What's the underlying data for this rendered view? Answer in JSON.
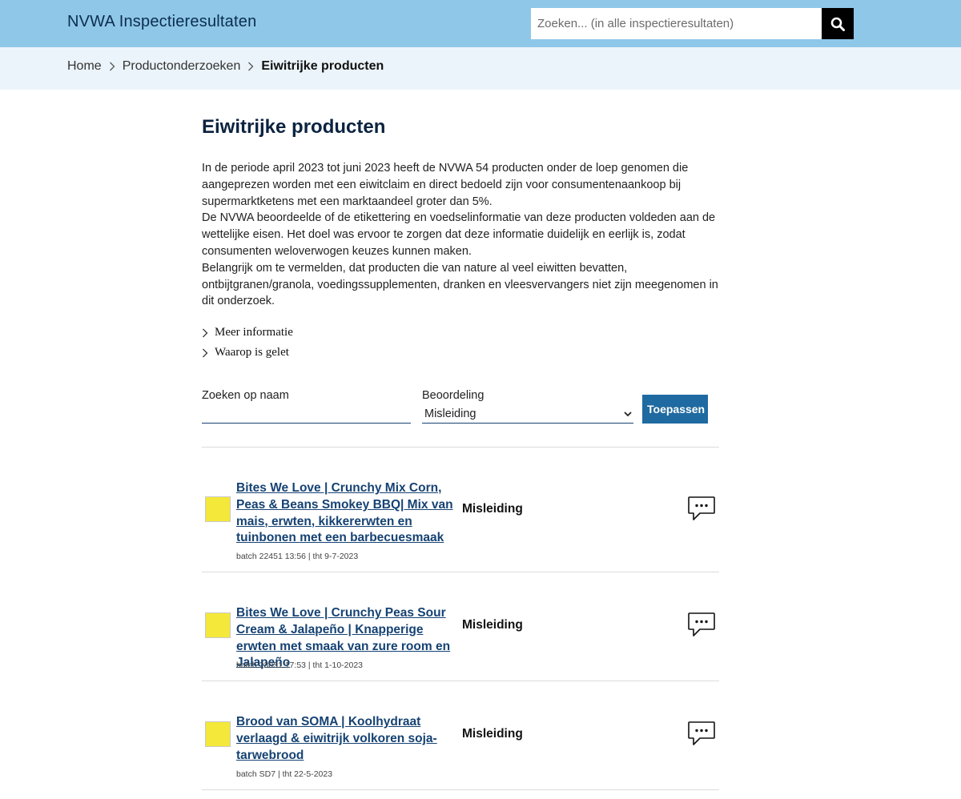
{
  "header": {
    "site_title": "NVWA Inspectieresultaten",
    "search_placeholder": "Zoeken... (in alle inspectieresultaten)"
  },
  "breadcrumb": {
    "items": [
      "Home",
      "Productonderzoeken"
    ],
    "current": "Eiwitrijke producten"
  },
  "page": {
    "title": "Eiwitrijke producten",
    "intro": [
      "In de periode april 2023 tot juni 2023 heeft de NVWA 54 producten onder de loep genomen die aangeprezen worden met een eiwitclaim en direct bedoeld zijn voor consumentenaankoop bij supermarktketens met een marktaandeel groter dan 5%.",
      "De NVWA beoordeelde of de etikettering en voedselinformatie van deze producten voldeden aan de wettelijke eisen. Het doel was ervoor te zorgen dat deze informatie duidelijk en eerlijk is, zodat consumenten weloverwogen keuzes kunnen maken.",
      "Belangrijk om te vermelden, dat producten die van nature al veel eiwitten bevatten, ontbijtgranen/granola, voedingssupplementen, dranken en vleesvervangers niet zijn meegenomen in dit onderzoek."
    ],
    "more_info_label": "Meer informatie",
    "attention_label": "Waarop is gelet"
  },
  "filters": {
    "name_label": "Zoeken op naam",
    "name_value": "",
    "rating_label": "Beoordeling",
    "rating_selected": "Misleiding",
    "apply_label": "Toepassen"
  },
  "colors": {
    "header_bg": "#8fc7e8",
    "breadcrumb_bg": "#ebf4fa",
    "link": "#154273",
    "button": "#1f6aa0",
    "rating_swatch": "#f4e83a"
  },
  "results": [
    {
      "title": "Bites We Love | Crunchy Mix Corn, Peas & Beans Smokey BBQ| Mix van mais, erwten, kikkererwten en tuinbonen met een barbecuesmaak",
      "batch": "batch 22451 13:56 | tht 9-7-2023",
      "verdict": "Misleiding",
      "icon": "comment-icon"
    },
    {
      "title": "Bites We Love | Crunchy Peas Sour Cream & Jalapeño | Knapperige erwten met smaak van zure room en Jalapeño",
      "batch": "batch 23051 17:53 | tht 1-10-2023",
      "verdict": "Misleiding",
      "icon": "comment-icon"
    },
    {
      "title": "Brood van SOMA | Koolhydraat verlaagd & eiwitrijk volkoren soja-tarwebrood",
      "batch": "batch SD7 | tht 22-5-2023",
      "verdict": "Misleiding",
      "icon": "comment-icon"
    }
  ]
}
